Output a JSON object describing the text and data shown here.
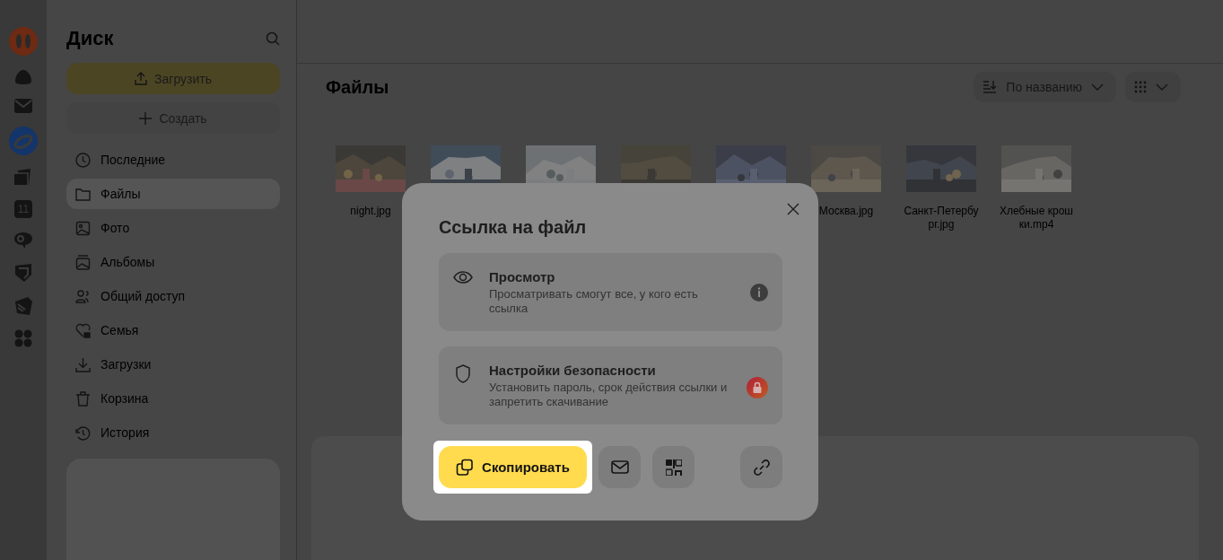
{
  "rail": {
    "calendar_date": "11"
  },
  "sidebar": {
    "title": "Диск",
    "upload_button": "Загрузить",
    "create_button": "Создать",
    "items": [
      {
        "label": "Последние",
        "selected": false
      },
      {
        "label": "Файлы",
        "selected": true
      },
      {
        "label": "Фото",
        "selected": false
      },
      {
        "label": "Альбомы",
        "selected": false
      },
      {
        "label": "Общий доступ",
        "selected": false
      },
      {
        "label": "Семья",
        "selected": false
      },
      {
        "label": "Загрузки",
        "selected": false
      },
      {
        "label": "Корзина",
        "selected": false
      },
      {
        "label": "История",
        "selected": false
      }
    ]
  },
  "main": {
    "title": "Файлы",
    "sort_button": "По названию",
    "files": [
      {
        "kind": "picture",
        "name": "night.jpg"
      },
      {
        "kind": "picture"
      },
      {
        "kind": "picture"
      },
      {
        "kind": "picture"
      },
      {
        "kind": "picture"
      },
      {
        "kind": "picture",
        "name": "Москва.jpg"
      },
      {
        "kind": "picture",
        "name": "Санкт-Петербург.jpg"
      },
      {
        "kind": "picture",
        "name": "Хлебные крошки.mp4"
      }
    ]
  },
  "modal": {
    "title": "Ссылка на файл",
    "options": [
      {
        "title": "Просмотр",
        "description": "Просматривать смогут все, у кого есть ссылка"
      },
      {
        "title": "Настройки безопасности",
        "description": "Установить пароль, срок действия ссылки и запретить скачивание"
      }
    ],
    "copy_button": "Скопировать"
  }
}
